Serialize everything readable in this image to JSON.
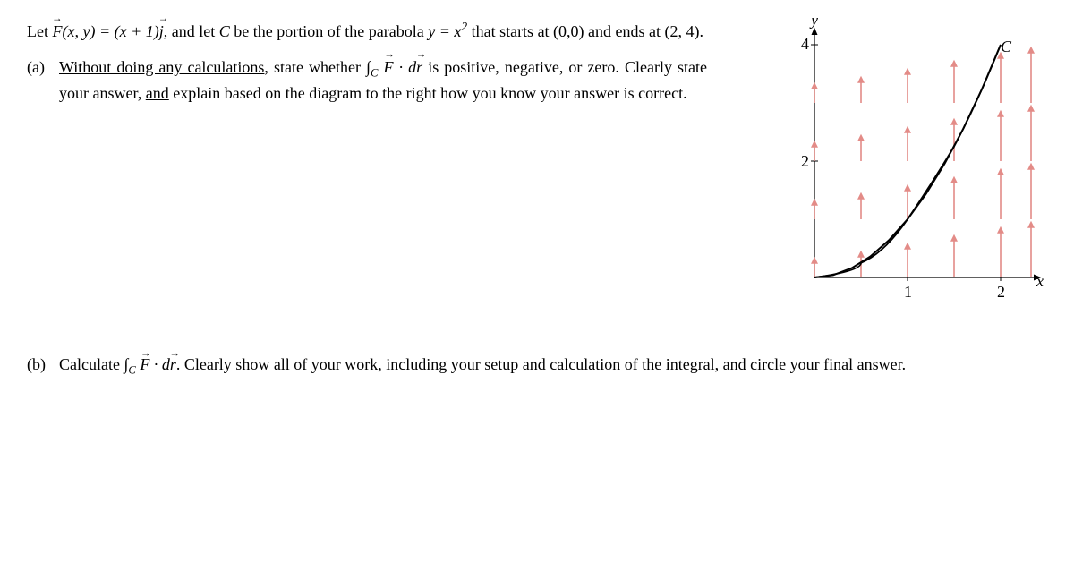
{
  "intro": {
    "prefix": "Let ",
    "fxy": "F(x, y) = (x + 1)j",
    "mid": ", and let ",
    "cvar": "C",
    "mid2": " be the portion of the parabola ",
    "eq": "y = x²",
    "mid3": " that starts at (0,0) and ends at (2, 4)."
  },
  "partA": {
    "label": "(a)",
    "text1": "Without doing any calculations",
    "text2": ", state whether ",
    "integral": "∫C F · dr",
    "text3": " is positive, negative, or zero. Clearly state your answer, ",
    "text4": "and",
    "text5": " explain based on the diagram to the right how you know your answer is correct."
  },
  "partB": {
    "label": "(b)",
    "text1": "Calculate ",
    "integral": "∫C F · dr",
    "text2": ". Clearly show all of your work, including your setup and calculation of the integral, and circle your final answer."
  },
  "diagram": {
    "yLabel": "y",
    "xLabel": "x",
    "curveLabel": "C",
    "yTick1": "4",
    "yTick2": "2",
    "xTick1": "1",
    "xTick2": "2"
  }
}
